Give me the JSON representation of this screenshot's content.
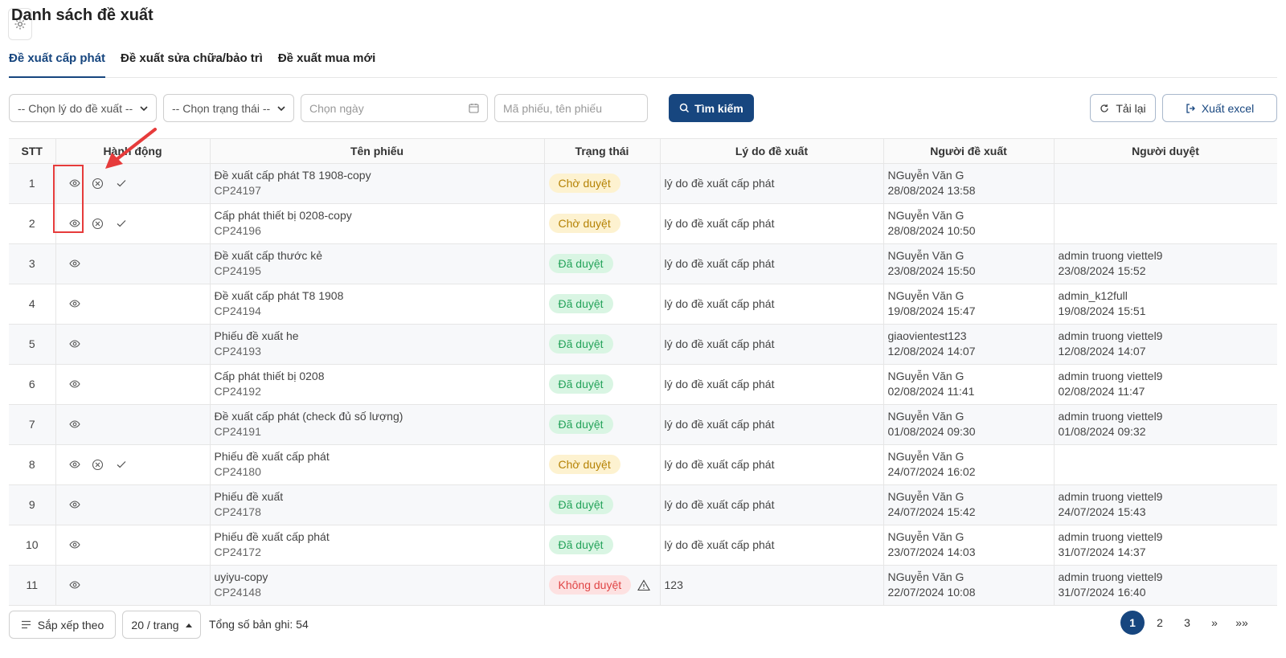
{
  "header": {
    "title": "Danh sách đề xuất"
  },
  "tabs": [
    {
      "label": "Đề xuất cấp phát",
      "active": true
    },
    {
      "label": "Đề xuất sửa chữa/bảo trì",
      "active": false
    },
    {
      "label": "Đề xuất mua mới",
      "active": false
    }
  ],
  "filters": {
    "reason": "-- Chọn lý do đề xuất --",
    "status": "-- Chọn trạng thái --",
    "date_placeholder": "Chọn ngày",
    "keyword_placeholder": "Mã phiếu, tên phiếu",
    "search_label": "Tìm kiếm",
    "reload_label": "Tải lại",
    "export_label": "Xuất excel"
  },
  "table": {
    "columns": [
      "STT",
      "Hành động",
      "Tên phiếu",
      "Trạng thái",
      "Lý do đề xuất",
      "Người đề xuất",
      "Người duyệt"
    ],
    "rows": [
      {
        "stt": "1",
        "name": "Đề xuất cấp phát T8 1908-copy",
        "code": "CP24197",
        "status": "Chờ duyệt",
        "reason": "lý do đề xuất cấp phát",
        "proposer": "NGuyễn Văn G",
        "proposed_at": "28/08/2024 13:58",
        "approver": "",
        "approved_at": ""
      },
      {
        "stt": "2",
        "name": "Cấp phát thiết bị 0208-copy",
        "code": "CP24196",
        "status": "Chờ duyệt",
        "reason": "lý do đề xuất cấp phát",
        "proposer": "NGuyễn Văn G",
        "proposed_at": "28/08/2024 10:50",
        "approver": "",
        "approved_at": ""
      },
      {
        "stt": "3",
        "name": "Đề xuất cấp thước kẻ",
        "code": "CP24195",
        "status": "Đã duyệt",
        "reason": "lý do đề xuất cấp phát",
        "proposer": "NGuyễn Văn G",
        "proposed_at": "23/08/2024 15:50",
        "approver": "admin truong viettel9",
        "approved_at": "23/08/2024 15:52"
      },
      {
        "stt": "4",
        "name": "Đề xuất cấp phát T8 1908",
        "code": "CP24194",
        "status": "Đã duyệt",
        "reason": "lý do đề xuất cấp phát",
        "proposer": "NGuyễn Văn G",
        "proposed_at": "19/08/2024 15:47",
        "approver": "admin_k12full",
        "approved_at": "19/08/2024 15:51"
      },
      {
        "stt": "5",
        "name": "Phiếu đề xuất he",
        "code": "CP24193",
        "status": "Đã duyệt",
        "reason": "lý do đề xuất cấp phát",
        "proposer": "giaovientest123",
        "proposed_at": "12/08/2024 14:07",
        "approver": "admin truong viettel9",
        "approved_at": "12/08/2024 14:07"
      },
      {
        "stt": "6",
        "name": "Cấp phát thiết bị 0208",
        "code": "CP24192",
        "status": "Đã duyệt",
        "reason": "lý do đề xuất cấp phát",
        "proposer": "NGuyễn Văn G",
        "proposed_at": "02/08/2024 11:41",
        "approver": "admin truong viettel9",
        "approved_at": "02/08/2024 11:47"
      },
      {
        "stt": "7",
        "name": "Đề xuất cấp phát (check đủ số lượng)",
        "code": "CP24191",
        "status": "Đã duyệt",
        "reason": "lý do đề xuất cấp phát",
        "proposer": "NGuyễn Văn G",
        "proposed_at": "01/08/2024 09:30",
        "approver": "admin truong viettel9",
        "approved_at": "01/08/2024 09:32"
      },
      {
        "stt": "8",
        "name": "Phiếu đề xuất cấp phát",
        "code": "CP24180",
        "status": "Chờ duyệt",
        "reason": "lý do đề xuất cấp phát",
        "proposer": "NGuyễn Văn G",
        "proposed_at": "24/07/2024 16:02",
        "approver": "",
        "approved_at": ""
      },
      {
        "stt": "9",
        "name": "Phiếu đề xuất",
        "code": "CP24178",
        "status": "Đã duyệt",
        "reason": "lý do đề xuất cấp phát",
        "proposer": "NGuyễn Văn G",
        "proposed_at": "24/07/2024 15:42",
        "approver": "admin truong viettel9",
        "approved_at": "24/07/2024 15:43"
      },
      {
        "stt": "10",
        "name": "Phiếu đề xuất cấp phát",
        "code": "CP24172",
        "status": "Đã duyệt",
        "reason": "lý do đề xuất cấp phát",
        "proposer": "NGuyễn Văn G",
        "proposed_at": "23/07/2024 14:03",
        "approver": "admin truong viettel9",
        "approved_at": "31/07/2024 14:37"
      },
      {
        "stt": "11",
        "name": "uyiyu-copy",
        "code": "CP24148",
        "status": "Không duyệt",
        "reason": "123",
        "proposer": "NGuyễn Văn G",
        "proposed_at": "22/07/2024 10:08",
        "approver": "admin truong viettel9",
        "approved_at": "31/07/2024 16:40"
      }
    ]
  },
  "footer": {
    "sort_label": "Sắp xếp theo",
    "page_size": "20 / trang",
    "total": "Tổng số bản ghi: 54",
    "pages": [
      "1",
      "2",
      "3"
    ],
    "next": "»",
    "last": "»»"
  },
  "colors": {
    "primary": "#17467f",
    "pending": "#b58204",
    "approved": "#24a35a",
    "rejected": "#e04545",
    "annotation": "#e63b3b"
  }
}
